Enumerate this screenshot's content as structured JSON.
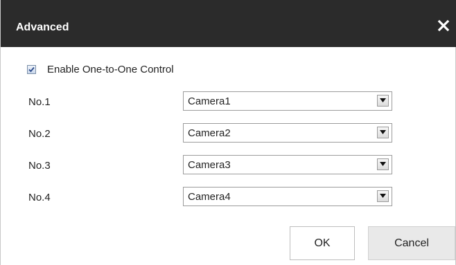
{
  "dialog": {
    "title": "Advanced",
    "close_icon": "close-icon"
  },
  "enable": {
    "checked": true,
    "label": "Enable One-to-One Control"
  },
  "rows": [
    {
      "label": "No.1",
      "value": "Camera1"
    },
    {
      "label": "No.2",
      "value": "Camera2"
    },
    {
      "label": "No.3",
      "value": "Camera3"
    },
    {
      "label": "No.4",
      "value": "Camera4"
    }
  ],
  "buttons": {
    "ok_label": "OK",
    "cancel_label": "Cancel"
  },
  "colors": {
    "titlebar": "#2b2b2b",
    "title_text": "#ffffff",
    "cancel_bg": "#e9e9e9"
  }
}
